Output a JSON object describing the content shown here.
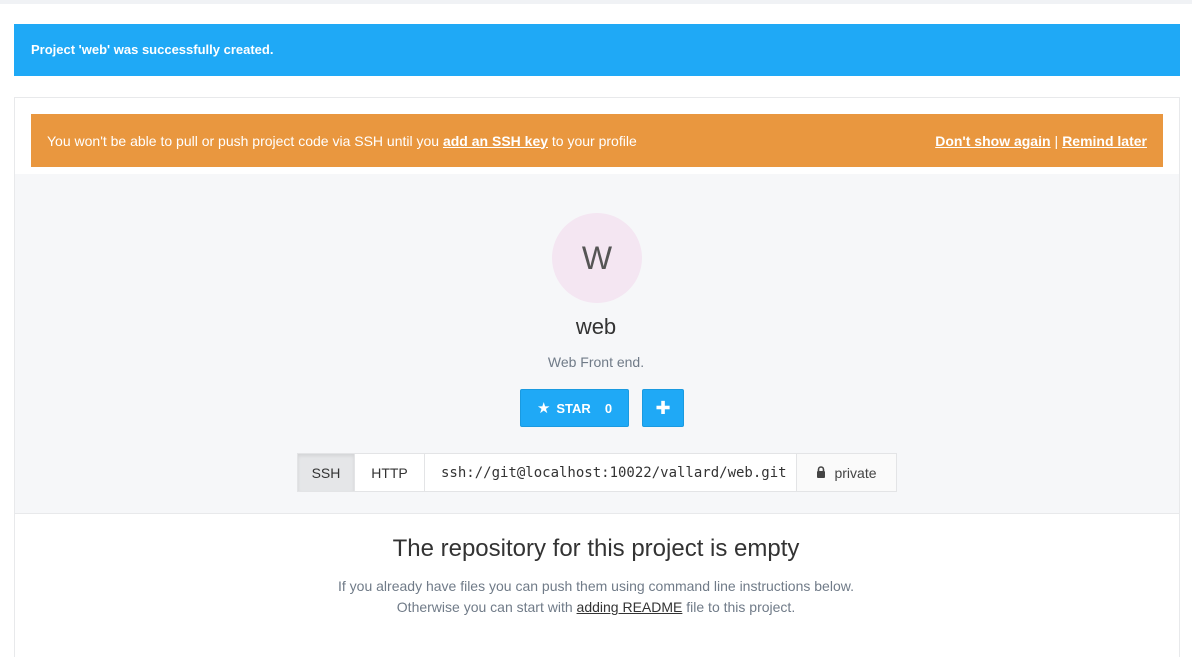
{
  "flash": {
    "message": "Project 'web' was successfully created."
  },
  "ssh_warning": {
    "text_before": "You won't be able to pull or push project code via SSH until you",
    "link": "add an SSH key",
    "text_after": "to your profile",
    "dont_show": "Don't show again",
    "separator": "|",
    "remind": "Remind later"
  },
  "project": {
    "avatar_letter": "W",
    "name": "web",
    "description": "Web Front end."
  },
  "actions": {
    "star_label": "STAR",
    "star_count": "0",
    "star_icon": "star-icon",
    "plus_icon": "plus-icon",
    "plus_symbol": "✚"
  },
  "clone": {
    "ssh_label": "SSH",
    "http_label": "HTTP",
    "url": "ssh://git@localhost:10022/vallard/web.git",
    "visibility": "private"
  },
  "empty": {
    "title": "The repository for this project is empty",
    "line1": "If you already have files you can push them using command line instructions below.",
    "line2_before": "Otherwise you can start with",
    "line2_link": "adding README",
    "line2_after": "file to this project."
  },
  "colors": {
    "flash_bg": "#1fa9f6",
    "warning_bg": "#e9973f",
    "primary": "#1fa9f6",
    "avatar_bg": "#f4e6f2"
  }
}
